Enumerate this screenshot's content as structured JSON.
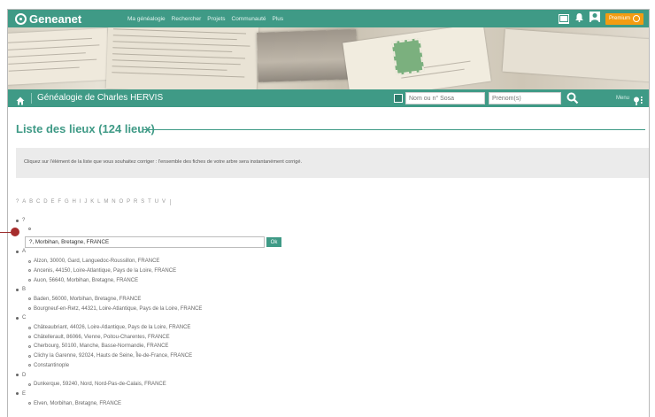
{
  "brand": {
    "logo_text": "Geneanet"
  },
  "topnav": [
    "Ma généalogie",
    "Rechercher",
    "Projets",
    "Communauté",
    "Plus"
  ],
  "top_icons": {
    "mail": "mail-icon",
    "bell": "bell-icon",
    "user": "user-icon"
  },
  "premium": {
    "label": "Premium",
    "icon": "power-icon"
  },
  "subbar": {
    "title": "Généalogie de Charles HERVIS",
    "sosa_placeholder": "Nom ou n° Sosa",
    "prenom_placeholder": "Prénom(s)",
    "menu_label": "Menu"
  },
  "page": {
    "title": "Liste des lieux (124 lieux)",
    "notice": "Cliquez sur l'élément de la liste que vous souhaitez corriger : l'ensemble des fiches de votre arbre sera instantanément corrigé."
  },
  "alphabet": [
    "?",
    "A",
    "B",
    "C",
    "D",
    "E",
    "F",
    "G",
    "H",
    "I",
    "J",
    "K",
    "L",
    "M",
    "N",
    "O",
    "P",
    "R",
    "S",
    "T",
    "U",
    "V"
  ],
  "edit": {
    "value": "?, Morbihan, Bretagne, FRANCE",
    "ok_label": "Ok"
  },
  "groups": [
    {
      "letter": "?",
      "items": [
        ""
      ]
    },
    {
      "letter": "A",
      "items": [
        "Alzon, 30000, Gard, Languedoc-Roussillon, FRANCE",
        "Ancenis, 44150, Loire-Atlantique, Pays de la Loire, FRANCE",
        "Auon, 56640, Morbihan, Bretagne, FRANCE"
      ]
    },
    {
      "letter": "B",
      "items": [
        "Baden, 56000, Morbihan, Bretagne, FRANCE",
        "Bourgneuf-en-Retz, 44321, Loire-Atlantique, Pays de la Loire, FRANCE"
      ]
    },
    {
      "letter": "C",
      "items": [
        "Châteaubriant, 44026, Loire-Atlantique, Pays de la Loire, FRANCE",
        "Châtellerault, 86066, Vienne, Poitou-Charentes, FRANCE",
        "Cherbourg, 50100, Manche, Basse-Normandie, FRANCE",
        "Clichy la Garenne, 92024, Hauts de Seine, Île-de-France, FRANCE",
        "Constantinople"
      ]
    },
    {
      "letter": "D",
      "items": [
        "Dunkerque, 59240, Nord, Nord-Pas-de-Calais, FRANCE"
      ]
    },
    {
      "letter": "E",
      "items": [
        "Elven, Morbihan, Bretagne, FRANCE"
      ]
    }
  ]
}
